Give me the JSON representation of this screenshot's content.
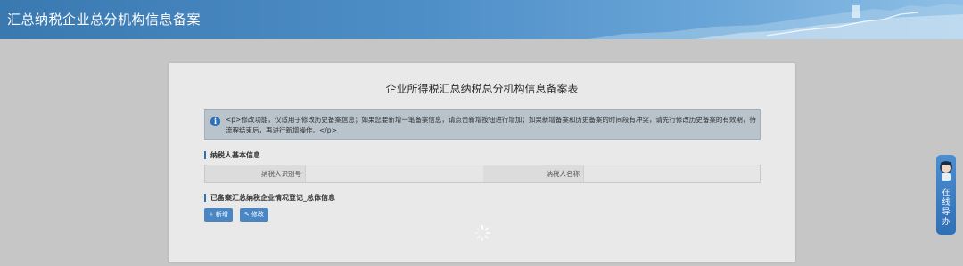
{
  "header": {
    "title": "汇总纳税企业总分机构信息备案"
  },
  "form": {
    "title": "企业所得税汇总纳税总分机构信息备案表",
    "notice": "<p>修改功能，仅适用于修改历史备案信息；如果您要新增一笔备案信息，请点击新增按钮进行增加；如果新增备案和历史备案的时间段有冲突，请先行修改历史备案的有效期，待流程结束后，再进行新增操作。</p>"
  },
  "basic_info": {
    "section_title": "纳税人基本信息",
    "fields": [
      {
        "label": "纳税人识别号",
        "value": ""
      },
      {
        "label": "纳税人名称",
        "value": ""
      }
    ]
  },
  "summary_info": {
    "section_title": "已备案汇总纳税企业情况登记_总体信息",
    "buttons": {
      "add": "新增",
      "edit": "修改"
    }
  },
  "side_widget": {
    "text": [
      "在",
      "线",
      "导",
      "办"
    ]
  },
  "colors": {
    "accent": "#2f6fb6",
    "button": "#4a86c4",
    "header": "#4f8fc8"
  }
}
